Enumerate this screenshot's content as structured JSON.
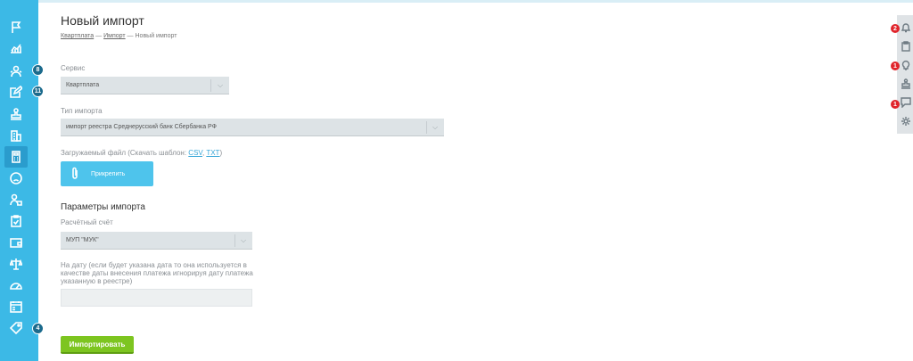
{
  "page": {
    "title": "Новый импорт",
    "breadcrumbs": [
      "Квартплата",
      "Импорт",
      "Новый импорт"
    ],
    "separator": "—"
  },
  "sidebar": {
    "items": [
      {
        "icon": "flag-icon"
      },
      {
        "icon": "chart-icon"
      },
      {
        "icon": "users-icon",
        "badge": "8"
      },
      {
        "icon": "edit-icon",
        "badge": "11"
      },
      {
        "icon": "stamp-icon"
      },
      {
        "icon": "building-icon"
      },
      {
        "icon": "calculator-icon",
        "active": true
      },
      {
        "icon": "sad-face-icon"
      },
      {
        "icon": "worker-icon"
      },
      {
        "icon": "clipboard-icon"
      },
      {
        "icon": "wallet-icon"
      },
      {
        "icon": "scales-icon"
      },
      {
        "icon": "gauge-icon"
      },
      {
        "icon": "calendar-icon"
      },
      {
        "icon": "tag-icon",
        "badge": "4"
      }
    ]
  },
  "right_panel": {
    "items": [
      {
        "icon": "bell-icon",
        "badge": "2"
      },
      {
        "icon": "clipboard-icon"
      },
      {
        "icon": "bulb-icon",
        "badge": "1"
      },
      {
        "icon": "stamp-icon"
      },
      {
        "icon": "chat-icon",
        "badge": "1"
      },
      {
        "icon": "gear-icon"
      }
    ]
  },
  "form": {
    "service_label": "Сервис",
    "service_value": "Квартплата",
    "import_type_label": "Тип импорта",
    "import_type_value": "импорт реестра Среднерусский банк Сбербанка РФ",
    "file_label_prefix": "Загружаемый файл (Скачать шаблон:",
    "file_template_csv": "CSV",
    "file_template_sep": ",",
    "file_template_txt": "TXT",
    "file_label_suffix": ")",
    "attach_label": "Прикрепить",
    "params_title": "Параметры импорта",
    "account_label": "Расчётный счёт",
    "account_value": "МУП \"МУК\"",
    "date_label": "На дату (если будет указана дата то она используется в качестве даты внесения платежа игнорируя дату платежа указанную в реестре)",
    "date_value": "",
    "import_button": "Импортировать"
  },
  "colors": {
    "sidebar": "#3cb9e6",
    "attach_button": "#4ec4ec",
    "import_button": "#7dc520",
    "badge_red": "#e0242b",
    "badge_dark": "#1b6a8c"
  }
}
